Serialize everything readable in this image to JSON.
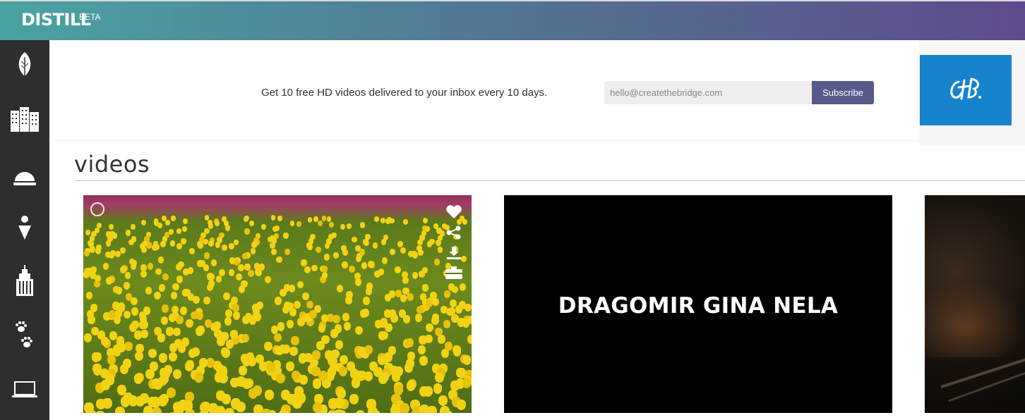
{
  "header": {
    "logo": "DISTILL",
    "badge": "BETA",
    "gradient": [
      "#4aa3a3",
      "#5e4a8c"
    ]
  },
  "sidebar": {
    "background": "#2e2e2e",
    "items": [
      {
        "icon": "leaf-icon"
      },
      {
        "icon": "buildings-icon"
      },
      {
        "icon": "food-dome-icon"
      },
      {
        "icon": "person-icon"
      },
      {
        "icon": "skyscraper-icon"
      },
      {
        "icon": "paw-prints-icon"
      },
      {
        "icon": "laptop-icon"
      }
    ]
  },
  "promo": {
    "text": "Get 10 free HD videos delivered to your inbox every 10 days.",
    "email_placeholder": "hello@createthebridge.com",
    "subscribe_label": "Subscribe"
  },
  "ad": {
    "logo": "CtB",
    "color": "#1783cc"
  },
  "section": {
    "title": "videos"
  },
  "videos": [
    {
      "thumbnail": "yellow-tulip-field",
      "actions": [
        "heart-icon",
        "share-icon",
        "download-icon",
        "embed-icon"
      ]
    },
    {
      "title": "DRAGOMIR GINA NELA"
    },
    {
      "thumbnail": "dark-portrait-partial"
    }
  ]
}
